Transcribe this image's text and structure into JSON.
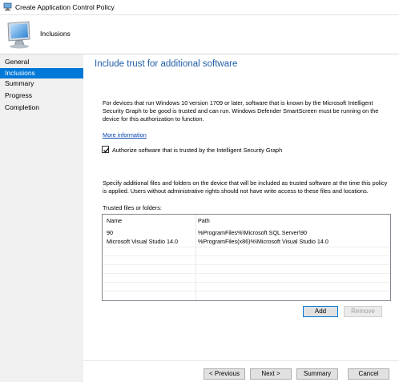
{
  "window": {
    "title": "Create Application Control Policy",
    "icon": "computer-icon"
  },
  "header": {
    "page_name": "Inclusions",
    "icon": "computer-monitor-icon"
  },
  "sidebar": {
    "items": [
      {
        "label": "General",
        "active": false
      },
      {
        "label": "Inclusions",
        "active": true
      },
      {
        "label": "Summary",
        "active": false
      },
      {
        "label": "Progress",
        "active": false
      },
      {
        "label": "Completion",
        "active": false
      }
    ]
  },
  "main": {
    "heading": "Include trust for additional software",
    "description": "For devices that run Windows 10 version 1709 or later, software that is known by the Microsoft Intelligent Security Graph to be good is trusted and can run. Windows Defender SmartScreen must be running on the device for this authorization to function.",
    "more_info_link": "More information",
    "checkbox": {
      "label": "Authorize software that is trusted by the Intelligent Security Graph",
      "checked": true
    },
    "description2": "Specify additional files and folders on the device that will be included as trusted software at the time this policy is applied. Users without administrative rights should not have write access to these files and locations.",
    "list_label": "Trusted files or folders:",
    "list": {
      "columns": [
        "Name",
        "Path"
      ],
      "rows": [
        [
          "90",
          "%ProgramFiles%\\Microsoft SQL Server\\90"
        ],
        [
          "Microsoft Visual Studio 14.0",
          "%ProgramFiles(x86)%\\Microsoft Visual Studio 14.0"
        ]
      ]
    },
    "add_button": "Add",
    "remove_button": "Remove"
  },
  "footer": {
    "previous": "< Previous",
    "next": "Next >",
    "summary": "Summary",
    "cancel": "Cancel"
  },
  "colors": {
    "accent": "#0078d7",
    "heading": "#1f5fa8",
    "link": "#0645ad"
  }
}
